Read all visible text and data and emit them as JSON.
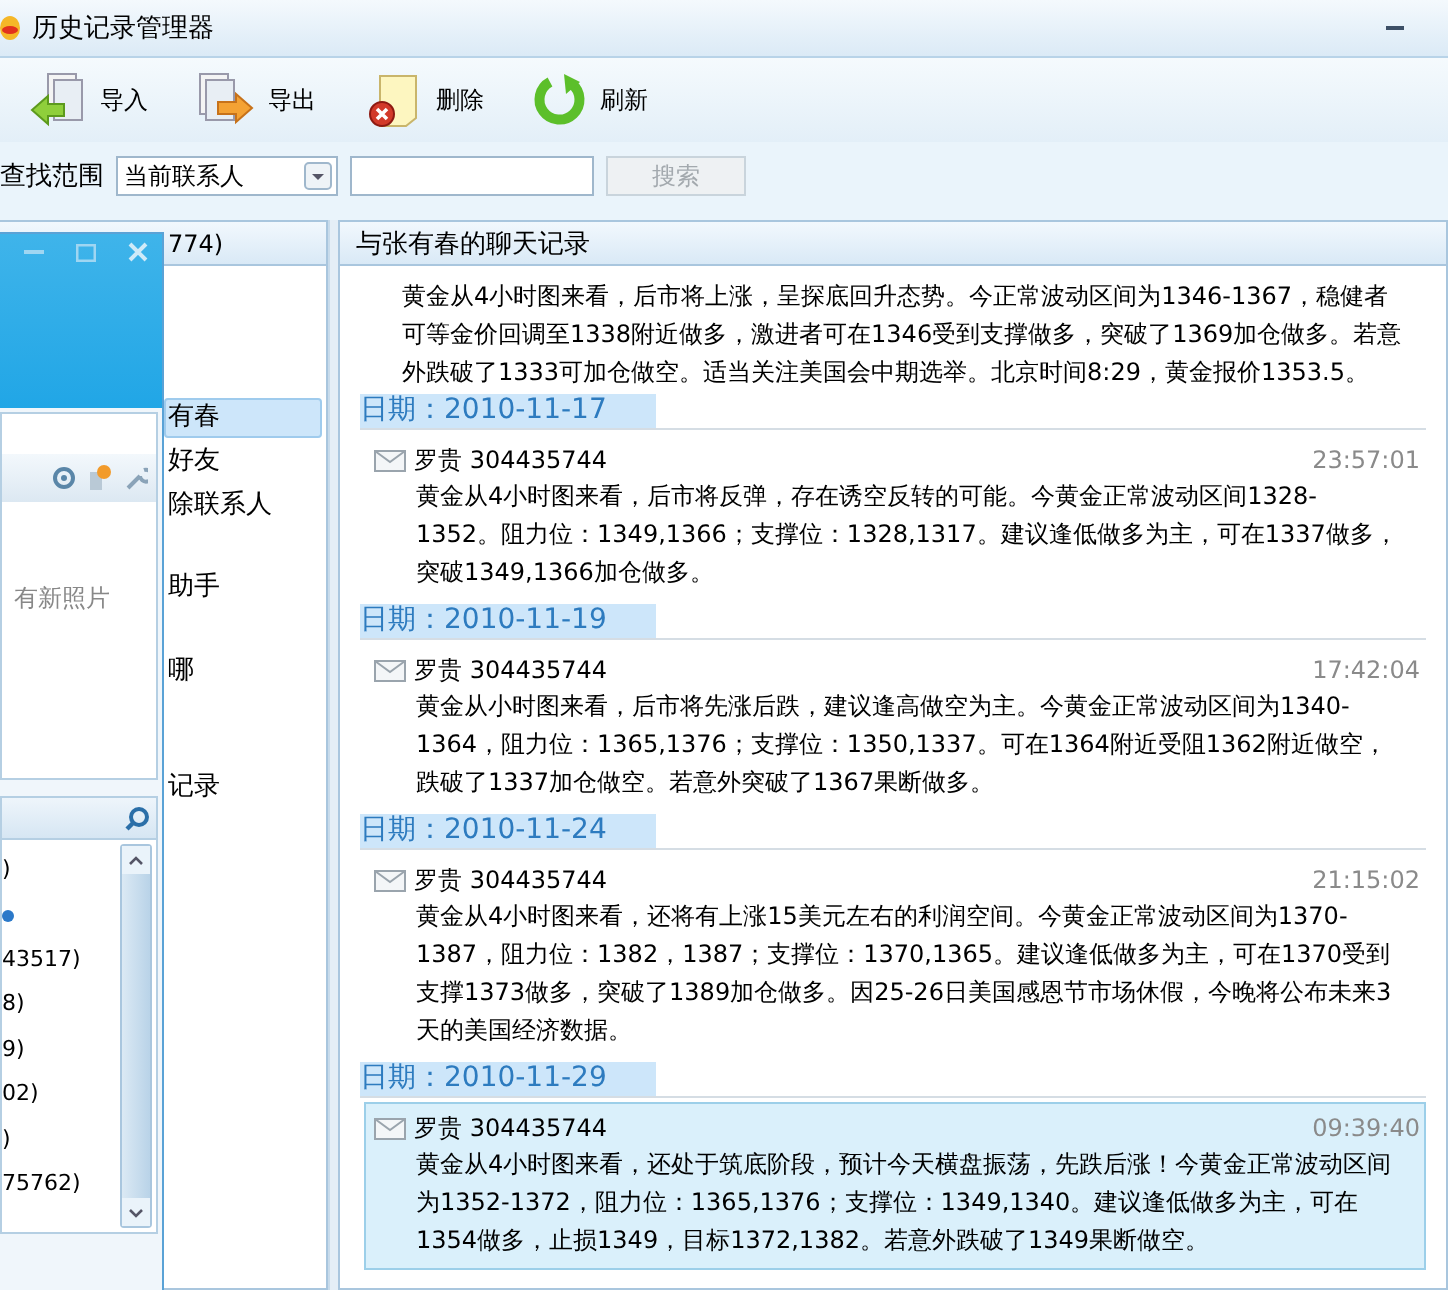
{
  "window": {
    "title": "历史记录管理器"
  },
  "toolbar": [
    {
      "label": "导入",
      "kind": "import"
    },
    {
      "label": "导出",
      "kind": "export"
    },
    {
      "label": "删除",
      "kind": "delete"
    },
    {
      "label": "刷新",
      "kind": "refresh"
    }
  ],
  "search": {
    "scope_label": "查找范围",
    "scope_value": "当前联系人",
    "button": "搜索"
  },
  "contacts": {
    "header": "774)",
    "items": [
      {
        "label": "有春",
        "selected": true
      },
      {
        "label": "好友",
        "selected": false
      },
      {
        "label": "除联系人",
        "selected": false
      },
      {
        "label": "助手",
        "selected": false
      },
      {
        "label": "哪",
        "selected": false
      },
      {
        "label": "记录",
        "selected": false
      }
    ]
  },
  "overlay_window": {
    "photo_note": "有新照片",
    "list": [
      {
        "kind": "text",
        "label": ")"
      },
      {
        "kind": "dot",
        "color": "#2b79c9"
      },
      {
        "kind": "text",
        "label": "43517)"
      },
      {
        "kind": "text",
        "label": "8)"
      },
      {
        "kind": "text",
        "label": "9)"
      },
      {
        "kind": "text",
        "label": "02)"
      },
      {
        "kind": "text",
        "label": ")"
      },
      {
        "kind": "text",
        "label": "75762)"
      }
    ]
  },
  "chat": {
    "title": "与张有春的聊天记录",
    "entries": [
      {
        "kind": "text",
        "body": "黄金从4小时图来看，后市将上涨，呈探底回升态势。今正常波动区间为1346-1367，稳健者可等金价回调至1338附近做多，激进者可在1346受到支撑做多，突破了1369加仓做多。若意外跌破了1333可加仓做空。适当关注美国会中期选举。北京时间8:29，黄金报价1353.5。"
      },
      {
        "kind": "date",
        "date": "日期：2010-11-17"
      },
      {
        "kind": "message",
        "sender": "罗贵 304435744",
        "time": "23:57:01",
        "selected": false,
        "body": "黄金从4小时图来看，后市将反弹，存在诱空反转的可能。今黄金正常波动区间1328-1352。阻力位：1349,1366；支撑位：1328,1317。建议逢低做多为主，可在1337做多，突破1349,1366加仓做多。"
      },
      {
        "kind": "date",
        "date": "日期：2010-11-19"
      },
      {
        "kind": "message",
        "sender": "罗贵 304435744",
        "time": "17:42:04",
        "selected": false,
        "body": "黄金从小时图来看，后市将先涨后跌，建议逢高做空为主。今黄金正常波动区间为1340-1364，阻力位：1365,1376；支撑位：1350,1337。可在1364附近受阻1362附近做空，跌破了1337加仓做空。若意外突破了1367果断做多。"
      },
      {
        "kind": "date",
        "date": "日期：2010-11-24"
      },
      {
        "kind": "message",
        "sender": "罗贵 304435744",
        "time": "21:15:02",
        "selected": false,
        "body": "黄金从4小时图来看，还将有上涨15美元左右的利润空间。今黄金正常波动区间为1370-1387，阻力位：1382，1387；支撑位：1370,1365。建议逢低做多为主，可在1370受到支撑1373做多，突破了1389加仓做多。因25-26日美国感恩节市场休假，今晚将公布未来3天的美国经济数据。"
      },
      {
        "kind": "date",
        "date": "日期：2010-11-29"
      },
      {
        "kind": "message",
        "sender": "罗贵 304435744",
        "time": "09:39:40",
        "selected": true,
        "body": "黄金从4小时图来看，还处于筑底阶段，预计今天横盘振荡，先跌后涨！今黄金正常波动区间为1352-1372，阻力位：1365,1376；支撑位：1349,1340。建议逢低做多为主，可在1354做多，止损1349，目标1372,1382。若意外跌破了1349果断做空。"
      }
    ]
  }
}
